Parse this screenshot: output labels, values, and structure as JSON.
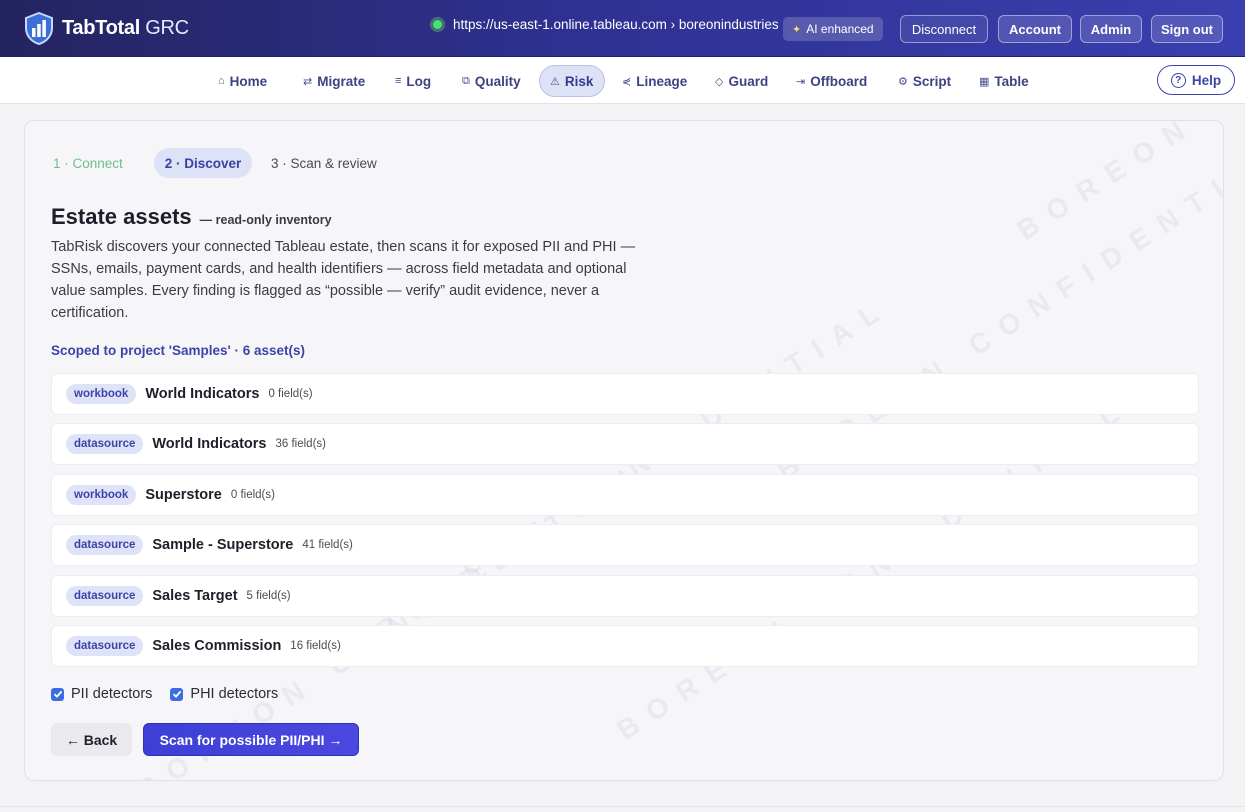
{
  "header": {
    "brand_bold": "TabTotal",
    "brand_light": " GRC",
    "connection_url": "https://us-east-1.online.tableau.com › boreonindustries",
    "ai_badge": "AI enhanced",
    "buttons": {
      "disconnect": "Disconnect",
      "account": "Account",
      "admin": "Admin",
      "sign_out": "Sign out"
    },
    "connection_status_color": "#4ade80"
  },
  "nav": {
    "items": [
      {
        "label": "Home",
        "icon": "home-icon"
      },
      {
        "label": "Migrate",
        "icon": "migrate-icon"
      },
      {
        "label": "Log",
        "icon": "log-icon"
      },
      {
        "label": "Quality",
        "icon": "quality-icon"
      },
      {
        "label": "Risk",
        "icon": "warning-icon",
        "active": true
      },
      {
        "label": "Lineage",
        "icon": "lineage-icon"
      },
      {
        "label": "Guard",
        "icon": "shield-icon"
      },
      {
        "label": "Offboard",
        "icon": "offboard-icon"
      },
      {
        "label": "Script",
        "icon": "gear-icon"
      },
      {
        "label": "Table",
        "icon": "table-icon"
      }
    ],
    "help": "Help"
  },
  "wizard": {
    "steps": [
      {
        "label": "1 · Connect",
        "state": "done"
      },
      {
        "label": "2 · Discover",
        "state": "current"
      },
      {
        "label": "3 · Scan & review",
        "state": "todo"
      }
    ]
  },
  "main": {
    "title": "Estate assets",
    "subtitle": "— read-only inventory",
    "description": "TabRisk discovers your connected Tableau estate, then scans it for exposed PII and PHI — SSNs, emails, payment cards, and health identifiers — across field metadata and optional value samples. Every finding is flagged as “possible — verify” audit evidence, never a certification.",
    "scope": "Scoped to project 'Samples' · 6 asset(s)",
    "assets": [
      {
        "type": "workbook",
        "name": "World Indicators",
        "fields": "0 field(s)"
      },
      {
        "type": "datasource",
        "name": "World Indicators",
        "fields": "36 field(s)"
      },
      {
        "type": "workbook",
        "name": "Superstore",
        "fields": "0 field(s)"
      },
      {
        "type": "datasource",
        "name": "Sample - Superstore",
        "fields": "41 field(s)"
      },
      {
        "type": "datasource",
        "name": "Sales Target",
        "fields": "5 field(s)"
      },
      {
        "type": "datasource",
        "name": "Sales Commission",
        "fields": "16 field(s)"
      }
    ],
    "detectors": [
      {
        "label": "PII detectors",
        "checked": true
      },
      {
        "label": "PHI detectors",
        "checked": true
      }
    ],
    "back_button": "← Back",
    "scan_button": "Scan for possible PII/PHI →",
    "watermark": "BOREON CONFIDENTIAL"
  },
  "colors": {
    "accent": "#3d44a8",
    "primary_button": "#3d3fd6",
    "header_gradient_start": "#24245f",
    "header_gradient_end": "#3a3fb0"
  }
}
